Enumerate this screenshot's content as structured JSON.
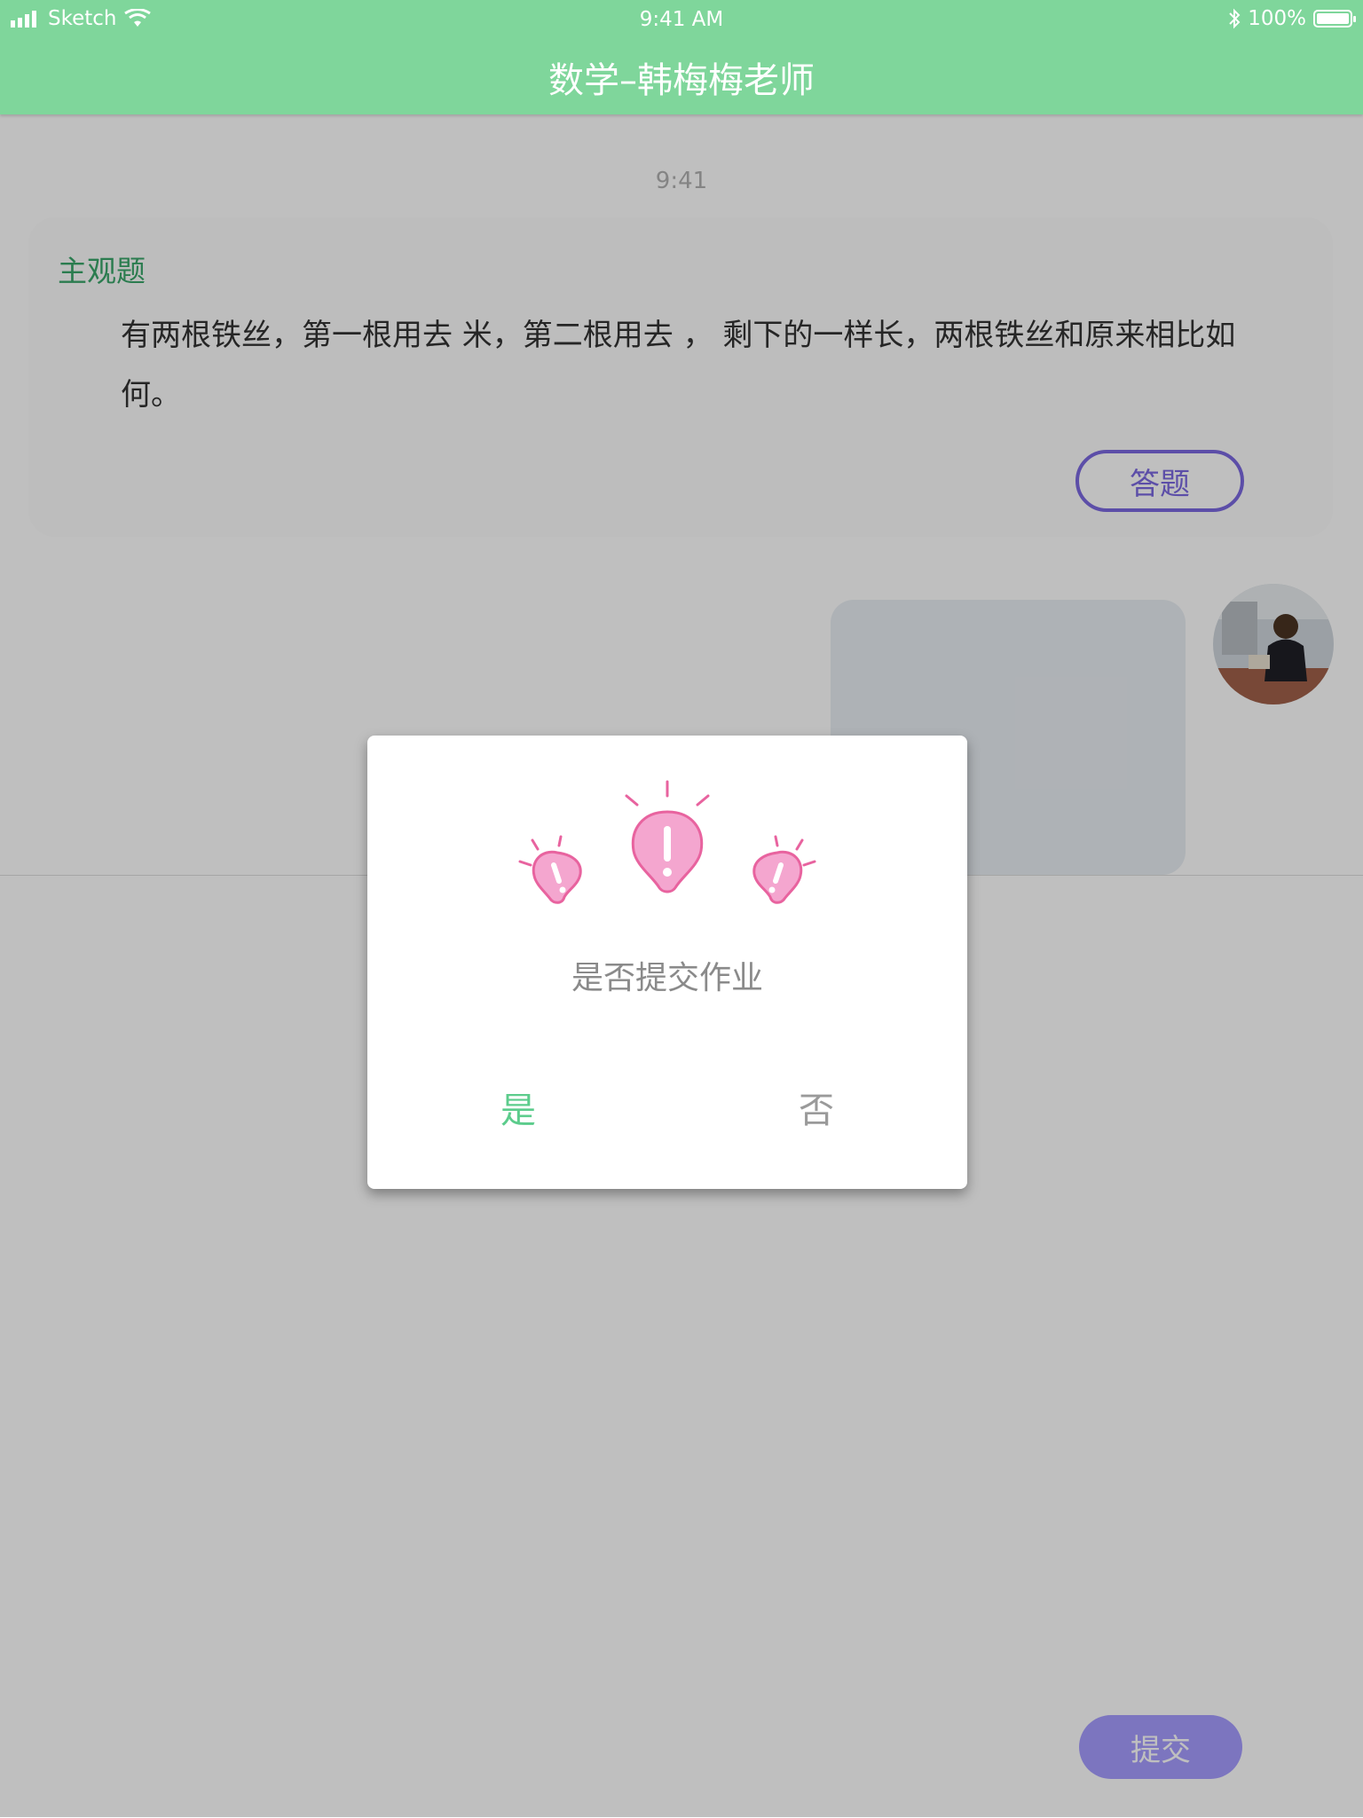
{
  "status_bar": {
    "carrier": "Sketch",
    "time": "9:41 AM",
    "battery": "100%"
  },
  "nav": {
    "title": "数学–韩梅梅老师"
  },
  "chat": {
    "timestamp": "9:41",
    "question_card": {
      "type_label": "主观题",
      "text": "有两根铁丝，第一根用去 米，第二根用去 ， 剩下的一样长，两根铁丝和原来相比如何。",
      "answer_button": "答题"
    }
  },
  "footer": {
    "submit_button": "提交"
  },
  "dialog": {
    "icon": "lightbulb-alert-icon",
    "message": "是否提交作业",
    "yes_label": "是",
    "no_label": "否"
  },
  "colors": {
    "nav_green": "#7fd69b",
    "accent_purple": "#7b68e0",
    "yes_green": "#5ccc8c",
    "bulb_pink": "#f4a6cf"
  }
}
